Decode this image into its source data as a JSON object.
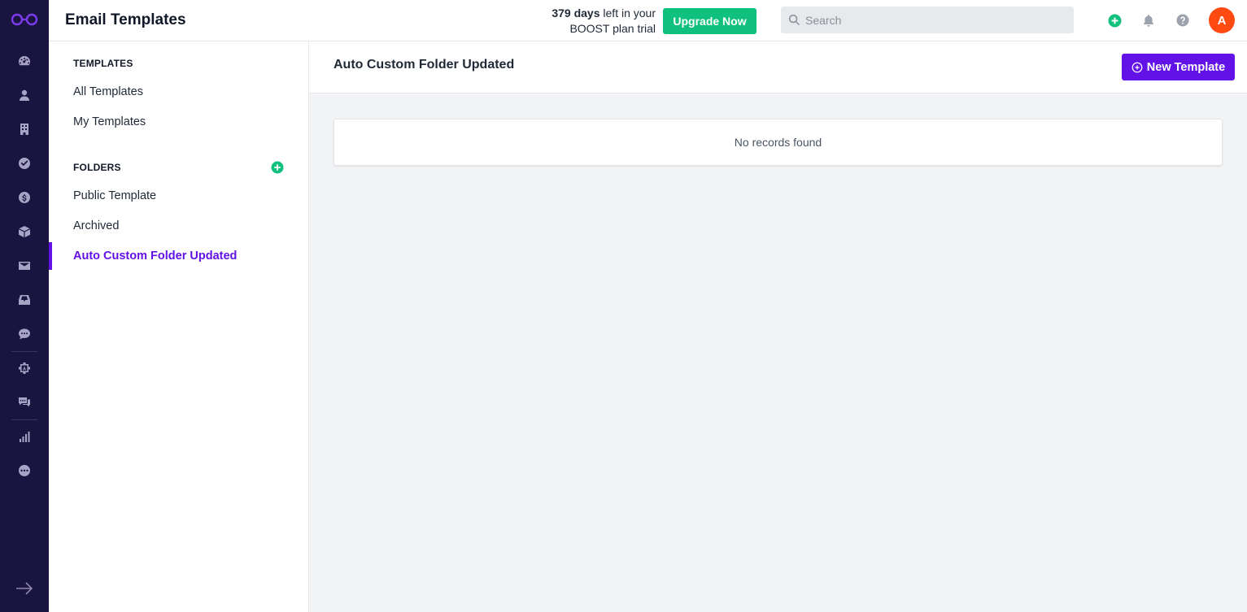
{
  "app": {
    "page_title": "Email Templates"
  },
  "colors": {
    "rail": "#1a1440",
    "accent": "#6211e6",
    "upgrade": "#10c17e",
    "avatar": "#ff4a12"
  },
  "header": {
    "trial_days": "379 days",
    "trial_line1_rest": " left in your",
    "trial_line2": "BOOST plan trial",
    "upgrade_label": "Upgrade Now",
    "search_placeholder": "Search",
    "avatar_initial": "A",
    "icons": [
      "add-circle-icon",
      "bell-icon",
      "help-icon"
    ]
  },
  "rail_icons": [
    "dashboard-icon",
    "contacts-icon",
    "companies-icon",
    "tasks-icon",
    "deals-icon",
    "products-icon",
    "email-icon",
    "inbox-icon",
    "chat-icon",
    "workflow-icon",
    "conversations-icon",
    "reports-icon",
    "more-icon"
  ],
  "sidebar": {
    "templates_heading": "TEMPLATES",
    "templates_items": [
      "All Templates",
      "My Templates"
    ],
    "folders_heading": "FOLDERS",
    "folder_items": [
      "Public Template",
      "Archived",
      "Auto Custom Folder Updated"
    ],
    "active_folder": "Auto Custom Folder Updated"
  },
  "main": {
    "title": "Auto Custom Folder Updated",
    "new_template_label": "New Template",
    "empty_message": "No records found"
  }
}
